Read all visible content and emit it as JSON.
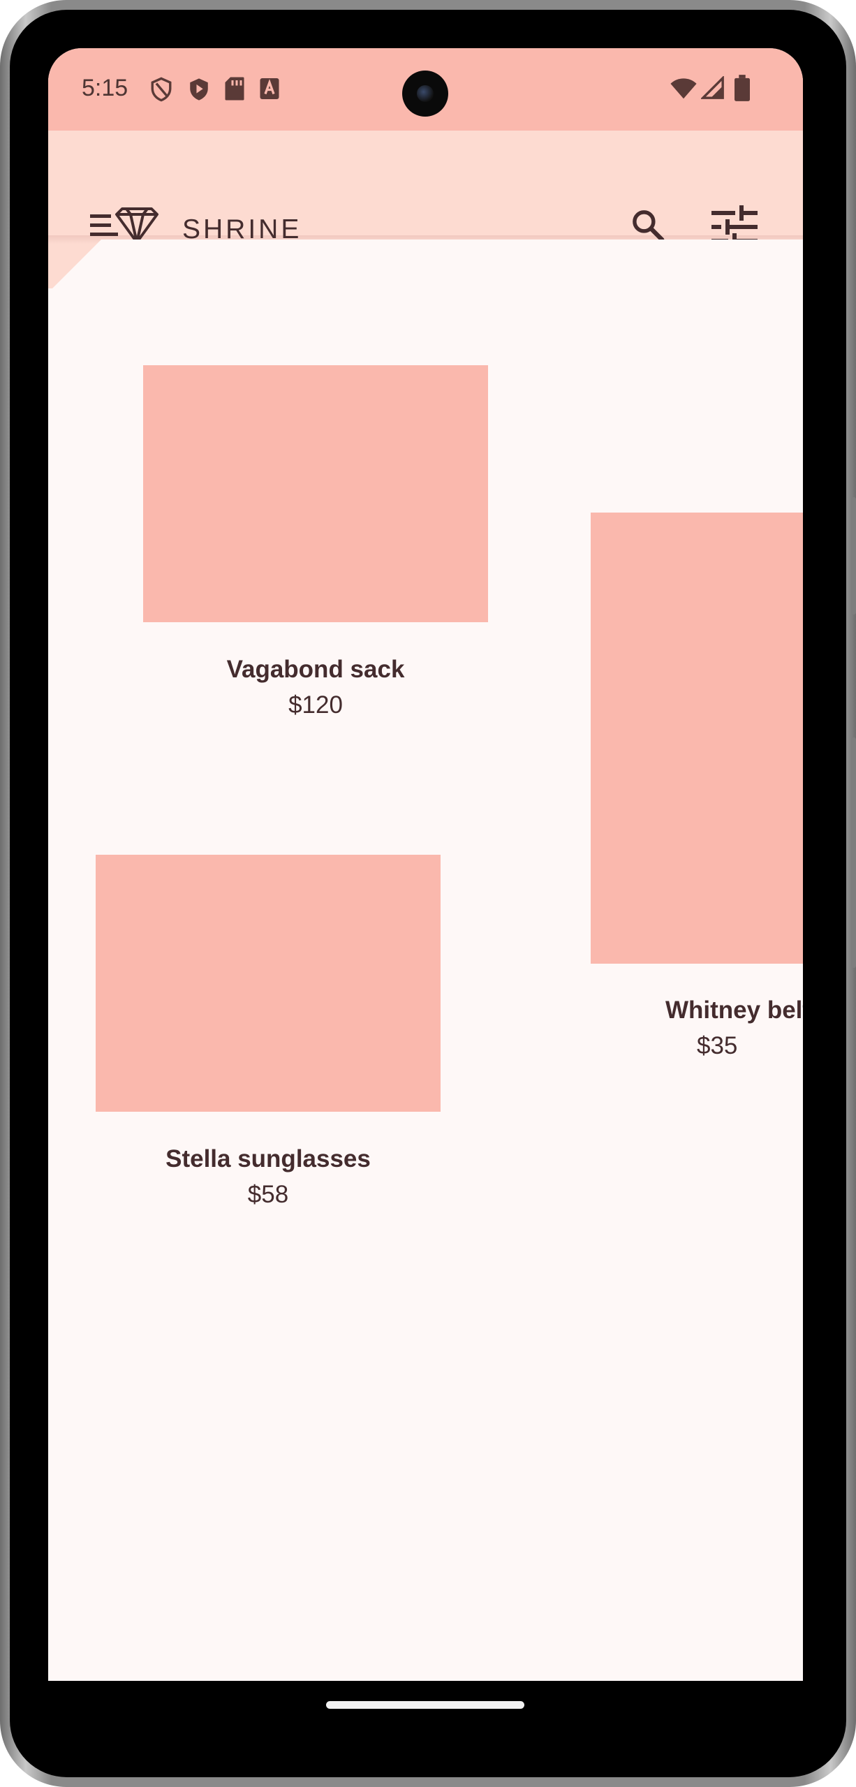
{
  "status_bar": {
    "time": "5:15",
    "left_icons": [
      "shield-outline-icon",
      "shield-play-icon",
      "sd-card-icon",
      "keyboard-a-icon"
    ],
    "right_icons": [
      "wifi-icon",
      "cell-signal-icon",
      "battery-icon"
    ]
  },
  "app_bar": {
    "title": "SHRINE",
    "actions": [
      "search-icon",
      "tune-icon"
    ]
  },
  "products": [
    {
      "name": "Vagabond sack",
      "price": "$120"
    },
    {
      "name": "Whitney belt",
      "price": "$35"
    },
    {
      "name": "Stella sunglasses",
      "price": "$58"
    }
  ],
  "colors": {
    "status_bar": "#fab8ad",
    "app_bar": "#fddbd1",
    "surface": "#fef8f7",
    "product_placeholder": "#fab8ad",
    "text": "#442c2e"
  }
}
